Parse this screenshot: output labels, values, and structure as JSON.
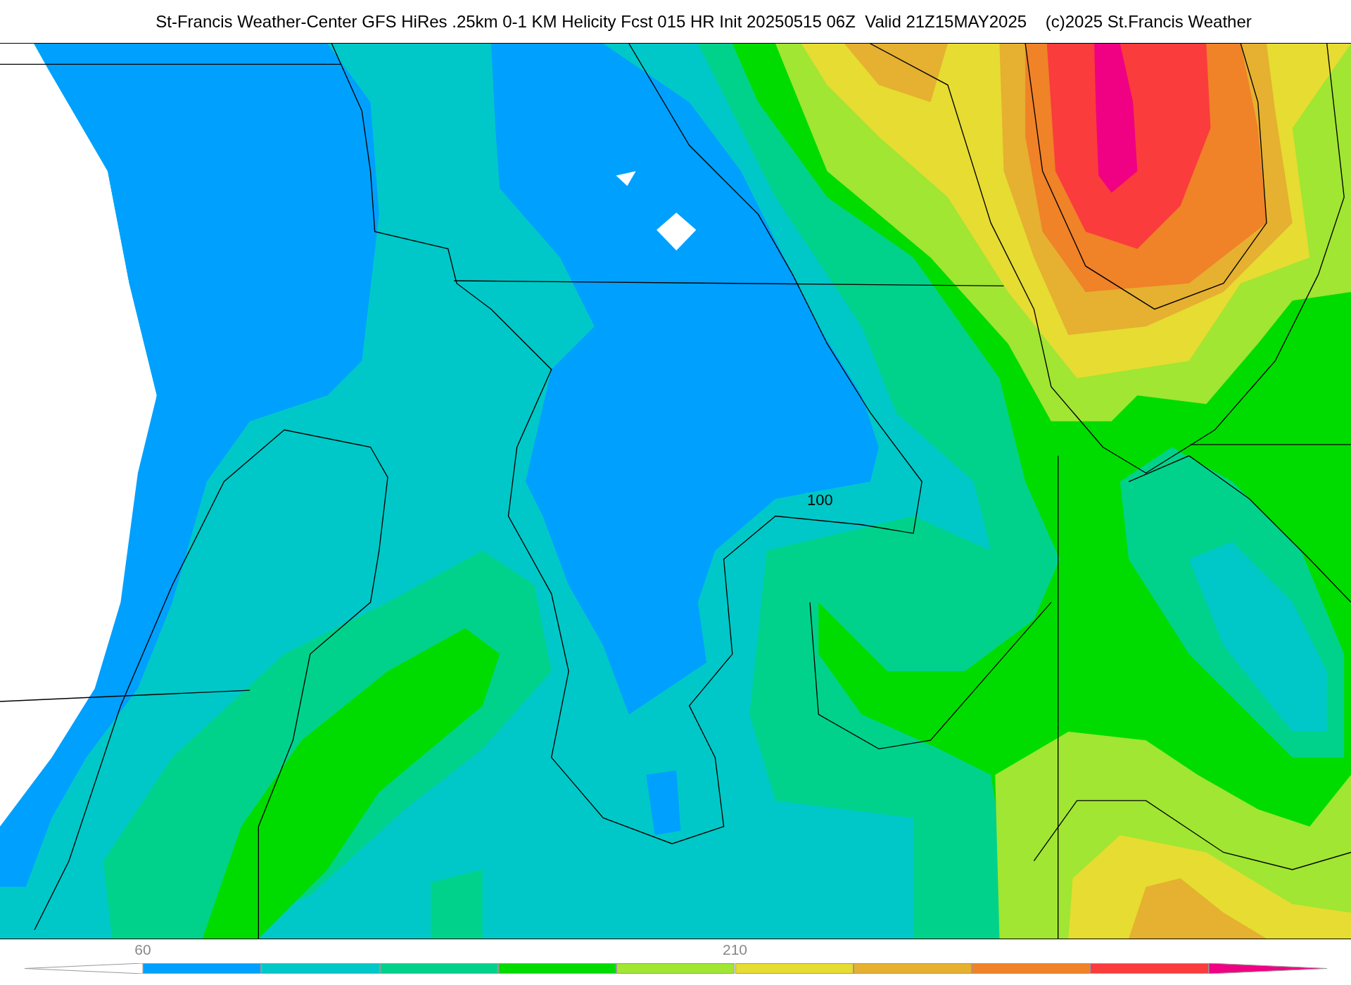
{
  "title": "St-Francis Weather-Center GFS HiRes .25km 0-1 KM Helicity Fcst 015 HR Init 20250515 06Z  Valid 21Z15MAY2025    (c)2025 St.Francis Weather",
  "map": {
    "contour_labels": [
      {
        "text": "100"
      }
    ]
  },
  "colorbar": {
    "segments": [
      {
        "kind": "arrow-left"
      },
      {
        "kind": "box",
        "color": "#00a0ff"
      },
      {
        "kind": "box",
        "color": "#00c8c8"
      },
      {
        "kind": "box",
        "color": "#00d28c"
      },
      {
        "kind": "box",
        "color": "#00dc00"
      },
      {
        "kind": "box",
        "color": "#a0e632"
      },
      {
        "kind": "box",
        "color": "#e6dc32"
      },
      {
        "kind": "box",
        "color": "#e6b030"
      },
      {
        "kind": "box",
        "color": "#f08228"
      },
      {
        "kind": "box",
        "color": "#fa3c3c"
      },
      {
        "kind": "arrow-right",
        "color": "#f00082"
      }
    ],
    "labels": [
      {
        "text": "60"
      },
      {
        "text": "210"
      }
    ]
  }
}
